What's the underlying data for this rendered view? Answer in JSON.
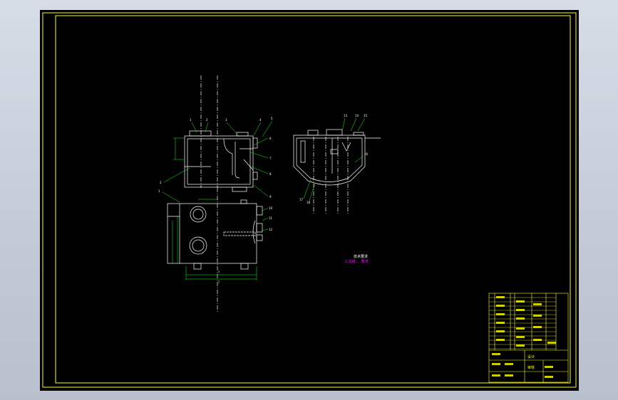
{
  "drawing": {
    "colors": {
      "background": "#000000",
      "frame": "#ffff00",
      "geometry": "#ffffff",
      "leaders": "#00ff00",
      "tags": "#ff00ff"
    },
    "front_view": {
      "callouts_top": [
        "1",
        "2",
        "3",
        "4",
        "5"
      ],
      "callouts_right": [
        "6",
        "7",
        "8",
        "9"
      ],
      "callouts_left": [
        "2",
        "1"
      ]
    },
    "bottom_view": {
      "callouts_right": [
        "10",
        "11",
        "12"
      ],
      "dims_bottom": [
        "?",
        "?"
      ]
    },
    "side_view": {
      "callouts_top": [
        "13",
        "14",
        "15"
      ],
      "callouts_right": [
        "16"
      ],
      "callouts_left": [
        "17",
        "18"
      ]
    },
    "tech_note": {
      "line1": "技术要求",
      "line2": "1.焊缝 ... 要求"
    },
    "title_block": {
      "label1": "设计",
      "label2": "审核"
    }
  }
}
